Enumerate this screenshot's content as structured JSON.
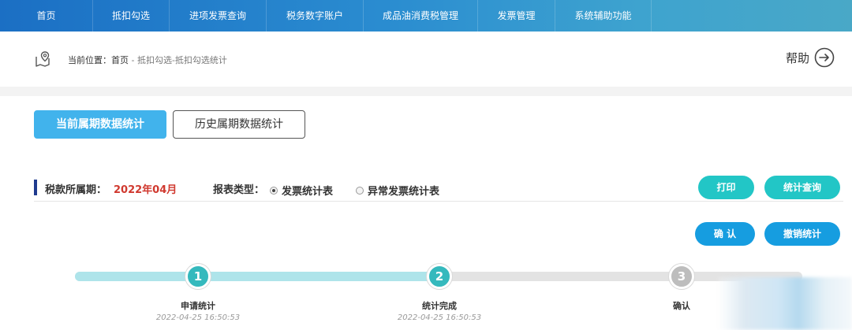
{
  "nav": {
    "items": [
      {
        "label": "首页"
      },
      {
        "label": "抵扣勾选"
      },
      {
        "label": "进项发票查询"
      },
      {
        "label": "税务数字账户"
      },
      {
        "label": "成品油消费税管理"
      },
      {
        "label": "发票管理"
      },
      {
        "label": "系统辅助功能"
      }
    ]
  },
  "breadcrumb": {
    "prefix": "当前位置：",
    "home": "首页",
    "trail": " - 抵扣勾选-抵扣勾选统计"
  },
  "help": {
    "label": "帮助"
  },
  "tabs": {
    "current": "当前属期数据统计",
    "history": "历史属期数据统计"
  },
  "filter": {
    "period_label": "税款所属期：",
    "period_value": "2022年04月",
    "report_type_label": "报表类型：",
    "options": [
      {
        "label": "发票统计表",
        "selected": true
      },
      {
        "label": "异常发票统计表",
        "selected": false
      }
    ]
  },
  "buttons": {
    "print": "打印",
    "stats_query": "统计查询",
    "confirm": "确 认",
    "revoke": "撤销统计"
  },
  "progress": {
    "completed_steps": 2,
    "steps": [
      {
        "number": "1",
        "label": "申请统计",
        "time": "2022-04-25 16:50:53"
      },
      {
        "number": "2",
        "label": "统计完成",
        "time": "2022-04-25 16:50:53"
      },
      {
        "number": "3",
        "label": "确认",
        "time": ""
      }
    ]
  },
  "colors": {
    "nav_start": "#1b6fc4",
    "nav_end": "#49a8c7",
    "tab_active": "#41b3ec",
    "teal_button": "#22c6c6",
    "blue_button": "#169de0",
    "period_red": "#d0392f",
    "step_done": "#35b9bd",
    "step_todo": "#bdbdbd"
  }
}
